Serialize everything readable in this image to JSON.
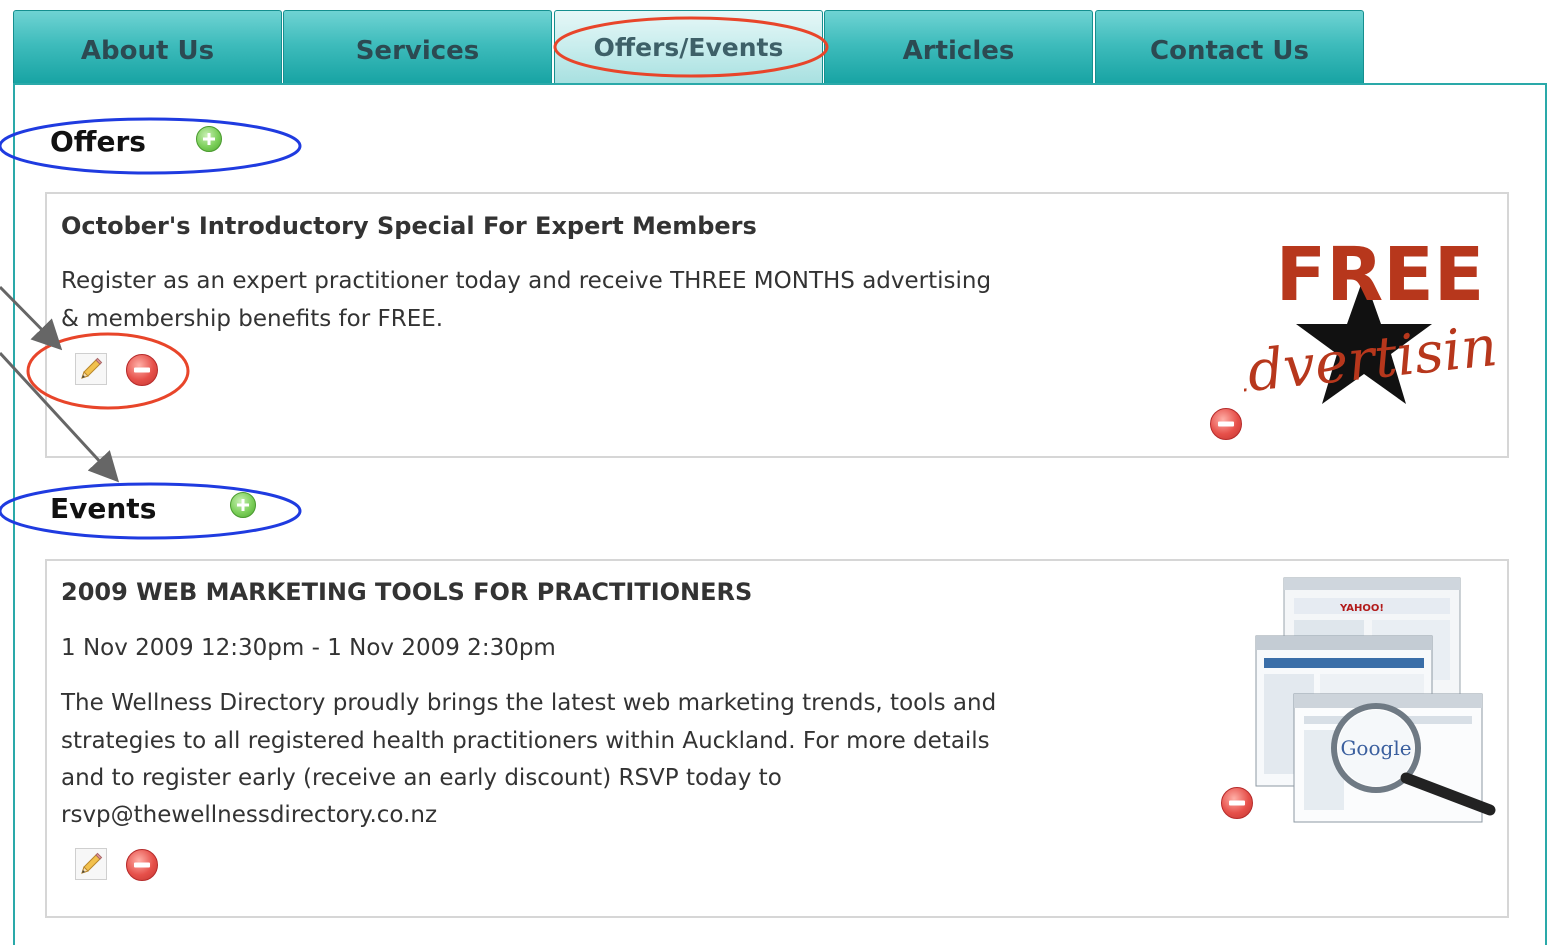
{
  "tabs": [
    {
      "label": "About Us",
      "active": false
    },
    {
      "label": "Services",
      "active": false
    },
    {
      "label": "Offers/Events",
      "active": true
    },
    {
      "label": "Articles",
      "active": false
    },
    {
      "label": "Contact Us",
      "active": false
    }
  ],
  "offers": {
    "heading": "Offers",
    "add_icon": "add-icon",
    "item": {
      "title": "October's Introductory Special For Expert Members",
      "body_line1": "Register as an expert practitioner today and receive THREE MONTHS advertising",
      "body_line2": "& membership benefits for FREE.",
      "image": {
        "word_top": "FREE",
        "word_script": "Advertising"
      },
      "edit_icon": "pencil-icon",
      "remove_icon": "remove-icon"
    }
  },
  "events": {
    "heading": "Events",
    "add_icon": "add-icon",
    "item": {
      "title": "2009 WEB MARKETING TOOLS FOR PRACTITIONERS",
      "datetime": "1 Nov 2009 12:30pm - 1 Nov 2009 2:30pm",
      "body_line1": "The Wellness Directory proudly brings the latest web marketing trends, tools and",
      "body_line2": "strategies to all registered health practitioners within Auckland. For more details",
      "body_line3": "and to register early (receive an early discount) RSVP today to",
      "body_line4": "rsvp@thewellnessdirectory.co.nz",
      "image": {
        "logo_text": "Google",
        "banner_text": "YAHOO!"
      },
      "edit_icon": "pencil-icon",
      "remove_icon": "remove-icon"
    }
  },
  "colors": {
    "tab_teal": "#2aa9a9",
    "annotation_red": "#e8452a",
    "annotation_blue": "#1f3be0",
    "free_red": "#b7371c"
  }
}
